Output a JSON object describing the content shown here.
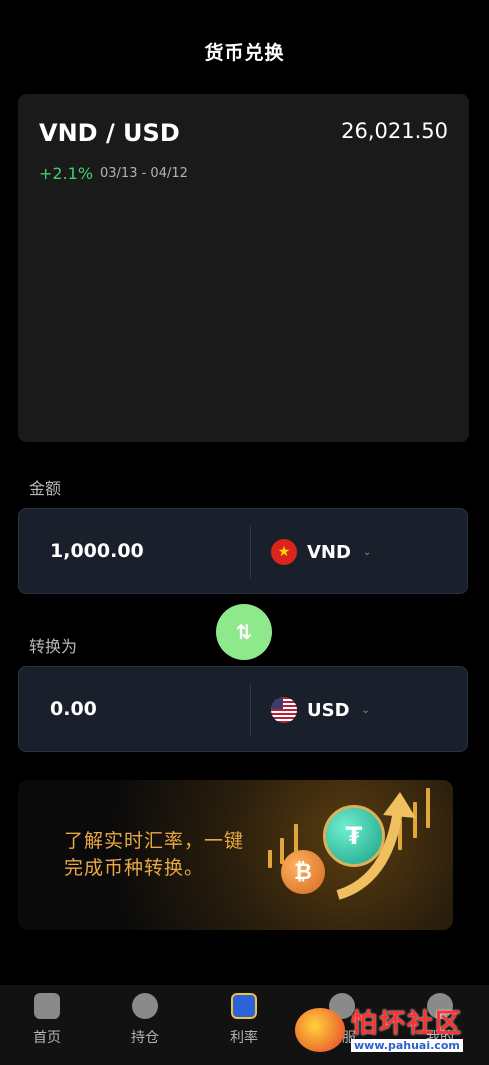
{
  "header": {
    "title": "货币兑换"
  },
  "chart_card": {
    "pair": "VND / USD",
    "rate": "26,021.50",
    "change": "+2.1%",
    "date_range": "03/13 - 04/12"
  },
  "from": {
    "label": "金额",
    "amount": "1,000.00",
    "currency": "VND",
    "flag_icon": "vietnam-flag-icon"
  },
  "to": {
    "label": "转换为",
    "amount": "0.00",
    "currency": "USD",
    "flag_icon": "us-flag-icon"
  },
  "swap_button": {
    "icon": "swap-vertical-icon",
    "glyph": "⇅"
  },
  "banner": {
    "line1": "了解实时汇率，一键",
    "line2": "完成币种转换。"
  },
  "nav": [
    {
      "label": "首页",
      "icon": "home-icon"
    },
    {
      "label": "持仓",
      "icon": "holdings-icon"
    },
    {
      "label": "利率",
      "icon": "rate-icon"
    },
    {
      "label": "客服",
      "icon": "chat-icon"
    },
    {
      "label": "我的",
      "icon": "profile-icon"
    }
  ],
  "watermark": {
    "name": "怕坏社区",
    "url": "www.pahuai.com"
  },
  "colors": {
    "positive": "#3bd16a",
    "swap": "#8ee98c",
    "card": "#1a202b",
    "banner_text": "#e8a845"
  }
}
